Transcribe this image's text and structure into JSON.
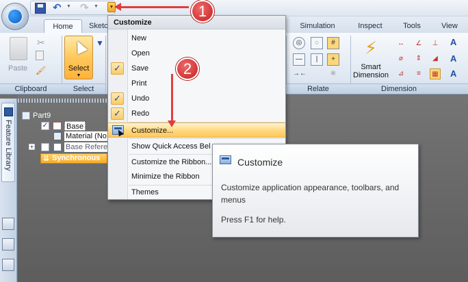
{
  "quick_access": {
    "toolbar_label": "Quick Access Toolbar"
  },
  "tabs": [
    {
      "label": "Home"
    },
    {
      "label": "Sketch"
    },
    {
      "label": "Simulation"
    },
    {
      "label": "Inspect"
    },
    {
      "label": "Tools"
    },
    {
      "label": "View"
    }
  ],
  "ribbon": {
    "clipboard": {
      "group_label": "Clipboard",
      "paste_label": "Paste"
    },
    "select": {
      "group_label": "Select",
      "tool_label": "Select"
    },
    "relate": {
      "group_label": "Relate"
    },
    "dimension": {
      "group_label": "Dimension",
      "smart_label_1": "Smart",
      "smart_label_2": "Dimension"
    }
  },
  "left_strip": {
    "feature_library_label": "Feature Library"
  },
  "tree": {
    "part": "Part9",
    "base": "Base",
    "material": "Material (No",
    "base_reference": "Base Refere",
    "synchronous": "Synchronous"
  },
  "menu": {
    "header": "Customize",
    "items": [
      {
        "label": "New",
        "checked": false
      },
      {
        "label": "Open",
        "checked": false
      },
      {
        "label": "Save",
        "checked": true
      },
      {
        "label": "Print",
        "checked": false
      },
      {
        "label": "Undo",
        "checked": true
      },
      {
        "label": "Redo",
        "checked": true
      },
      {
        "label": "Customize...",
        "checked": false
      },
      {
        "label": "Show Quick Access Bel",
        "checked": false
      },
      {
        "label": "Customize the Ribbon...",
        "checked": false
      },
      {
        "label": "Minimize the Ribbon",
        "checked": false
      },
      {
        "label": "Themes",
        "checked": false
      }
    ]
  },
  "tooltip": {
    "title": "Customize",
    "description": "Customize application appearance, toolbars, and menus",
    "help": "Press F1 for help."
  },
  "callouts": {
    "one": "1",
    "two": "2"
  },
  "colors": {
    "accent_orange": "#f6ad2a",
    "callout_red": "#c41f1f",
    "ribbon_blue": "#dde6f1"
  }
}
